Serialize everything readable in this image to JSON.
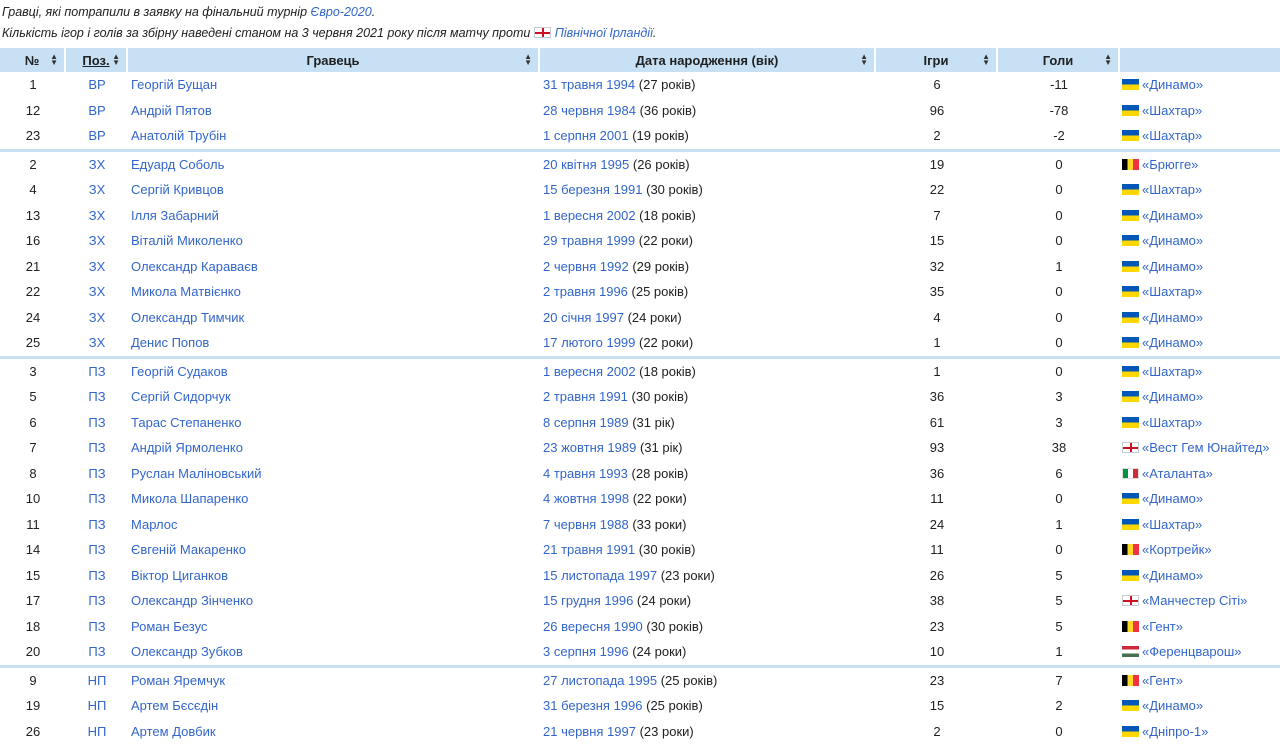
{
  "intro": {
    "line1_text": "Гравці, які потрапили в заявку на фінальний турнір ",
    "line1_link": "Євро-2020",
    "line1_end": ".",
    "line2_text": "Кількість ігор і голів за збірну наведені станом на 3 червня 2021 року після матчу проти ",
    "line2_link": "Північної Ірландії",
    "line2_end": "."
  },
  "headers": {
    "num": "№",
    "pos": "Поз.",
    "player": "Гравець",
    "dob": "Дата народження (вік)",
    "games": "Ігри",
    "goals": "Голи",
    "club": ""
  },
  "sort_icon": "sort-arrows-icon",
  "colors": {
    "header_bg": "#c7e0f4",
    "link": "#3366cc"
  },
  "rows": [
    {
      "num": "1",
      "pos": "ВР",
      "player": "Георгій Бущан",
      "date": "31 травня 1994",
      "age": " (27 років)",
      "games": "6",
      "goals": "-11",
      "flag": "ua",
      "club": "«Динамо»"
    },
    {
      "num": "12",
      "pos": "ВР",
      "player": "Андрій Пятов",
      "date": "28 червня 1984",
      "age": " (36 років)",
      "games": "96",
      "goals": "-78",
      "flag": "ua",
      "club": "«Шахтар»"
    },
    {
      "num": "23",
      "pos": "ВР",
      "player": "Анатолій Трубін",
      "date": "1 серпня 2001",
      "age": " (19 років)",
      "games": "2",
      "goals": "-2",
      "flag": "ua",
      "club": "«Шахтар»"
    },
    {
      "num": "2",
      "pos": "ЗХ",
      "player": "Едуард Соболь",
      "date": "20 квітня 1995",
      "age": " (26 років)",
      "games": "19",
      "goals": "0",
      "flag": "be",
      "club": "«Брюгге»"
    },
    {
      "num": "4",
      "pos": "ЗХ",
      "player": "Сергій Кривцов",
      "date": "15 березня 1991",
      "age": " (30 років)",
      "games": "22",
      "goals": "0",
      "flag": "ua",
      "club": "«Шахтар»"
    },
    {
      "num": "13",
      "pos": "ЗХ",
      "player": "Ілля Забарний",
      "date": "1 вересня 2002",
      "age": " (18 років)",
      "games": "7",
      "goals": "0",
      "flag": "ua",
      "club": "«Динамо»"
    },
    {
      "num": "16",
      "pos": "ЗХ",
      "player": "Віталій Миколенко",
      "date": "29 травня 1999",
      "age": " (22 роки)",
      "games": "15",
      "goals": "0",
      "flag": "ua",
      "club": "«Динамо»"
    },
    {
      "num": "21",
      "pos": "ЗХ",
      "player": "Олександр Караваєв",
      "date": "2 червня 1992",
      "age": " (29 років)",
      "games": "32",
      "goals": "1",
      "flag": "ua",
      "club": "«Динамо»"
    },
    {
      "num": "22",
      "pos": "ЗХ",
      "player": "Микола Матвієнко",
      "date": "2 травня 1996",
      "age": " (25 років)",
      "games": "35",
      "goals": "0",
      "flag": "ua",
      "club": "«Шахтар»"
    },
    {
      "num": "24",
      "pos": "ЗХ",
      "player": "Олександр Тимчик",
      "date": "20 січня 1997",
      "age": " (24 роки)",
      "games": "4",
      "goals": "0",
      "flag": "ua",
      "club": "«Динамо»"
    },
    {
      "num": "25",
      "pos": "ЗХ",
      "player": "Денис Попов",
      "date": "17 лютого 1999",
      "age": " (22 роки)",
      "games": "1",
      "goals": "0",
      "flag": "ua",
      "club": "«Динамо»"
    },
    {
      "num": "3",
      "pos": "ПЗ",
      "player": "Георгій Судаков",
      "date": "1 вересня 2002",
      "age": " (18 років)",
      "games": "1",
      "goals": "0",
      "flag": "ua",
      "club": "«Шахтар»"
    },
    {
      "num": "5",
      "pos": "ПЗ",
      "player": "Сергій Сидорчук",
      "date": "2 травня 1991",
      "age": " (30 років)",
      "games": "36",
      "goals": "3",
      "flag": "ua",
      "club": "«Динамо»"
    },
    {
      "num": "6",
      "pos": "ПЗ",
      "player": "Тарас Степаненко",
      "date": "8 серпня 1989",
      "age": " (31 рік)",
      "games": "61",
      "goals": "3",
      "flag": "ua",
      "club": "«Шахтар»"
    },
    {
      "num": "7",
      "pos": "ПЗ",
      "player": "Андрій Ярмоленко",
      "date": "23 жовтня 1989",
      "age": " (31 рік)",
      "games": "93",
      "goals": "38",
      "flag": "en",
      "club": "«Вест Гем Юнайтед»"
    },
    {
      "num": "8",
      "pos": "ПЗ",
      "player": "Руслан Маліновський",
      "date": "4 травня 1993",
      "age": " (28 років)",
      "games": "36",
      "goals": "6",
      "flag": "it",
      "club": "«Аталанта»"
    },
    {
      "num": "10",
      "pos": "ПЗ",
      "player": "Микола Шапаренко",
      "date": "4 жовтня 1998",
      "age": " (22 роки)",
      "games": "11",
      "goals": "0",
      "flag": "ua",
      "club": "«Динамо»"
    },
    {
      "num": "11",
      "pos": "ПЗ",
      "player": "Марлос",
      "date": "7 червня 1988",
      "age": " (33 роки)",
      "games": "24",
      "goals": "1",
      "flag": "ua",
      "club": "«Шахтар»"
    },
    {
      "num": "14",
      "pos": "ПЗ",
      "player": "Євгеній Макаренко",
      "date": "21 травня 1991",
      "age": " (30 років)",
      "games": "11",
      "goals": "0",
      "flag": "be",
      "club": "«Кортрейк»"
    },
    {
      "num": "15",
      "pos": "ПЗ",
      "player": "Віктор Циганков",
      "date": "15 листопада 1997",
      "age": " (23 роки)",
      "games": "26",
      "goals": "5",
      "flag": "ua",
      "club": "«Динамо»"
    },
    {
      "num": "17",
      "pos": "ПЗ",
      "player": "Олександр Зінченко",
      "date": "15 грудня 1996",
      "age": " (24 роки)",
      "games": "38",
      "goals": "5",
      "flag": "en",
      "club": "«Манчестер Сіті»"
    },
    {
      "num": "18",
      "pos": "ПЗ",
      "player": "Роман Безус",
      "date": "26 вересня 1990",
      "age": " (30 років)",
      "games": "23",
      "goals": "5",
      "flag": "be",
      "club": "«Гент»"
    },
    {
      "num": "20",
      "pos": "ПЗ",
      "player": "Олександр Зубков",
      "date": "3 серпня 1996",
      "age": " (24 роки)",
      "games": "10",
      "goals": "1",
      "flag": "hu",
      "club": "«Ференцварош»"
    },
    {
      "num": "9",
      "pos": "НП",
      "player": "Роман Яремчук",
      "date": "27 листопада 1995",
      "age": " (25 років)",
      "games": "23",
      "goals": "7",
      "flag": "be",
      "club": "«Гент»"
    },
    {
      "num": "19",
      "pos": "НП",
      "player": "Артем Бєсєдін",
      "date": "31 березня 1996",
      "age": " (25 років)",
      "games": "15",
      "goals": "2",
      "flag": "ua",
      "club": "«Динамо»"
    },
    {
      "num": "26",
      "pos": "НП",
      "player": "Артем Довбик",
      "date": "21 червня 1997",
      "age": " (23 роки)",
      "games": "2",
      "goals": "0",
      "flag": "ua",
      "club": "«Дніпро-1»"
    }
  ]
}
